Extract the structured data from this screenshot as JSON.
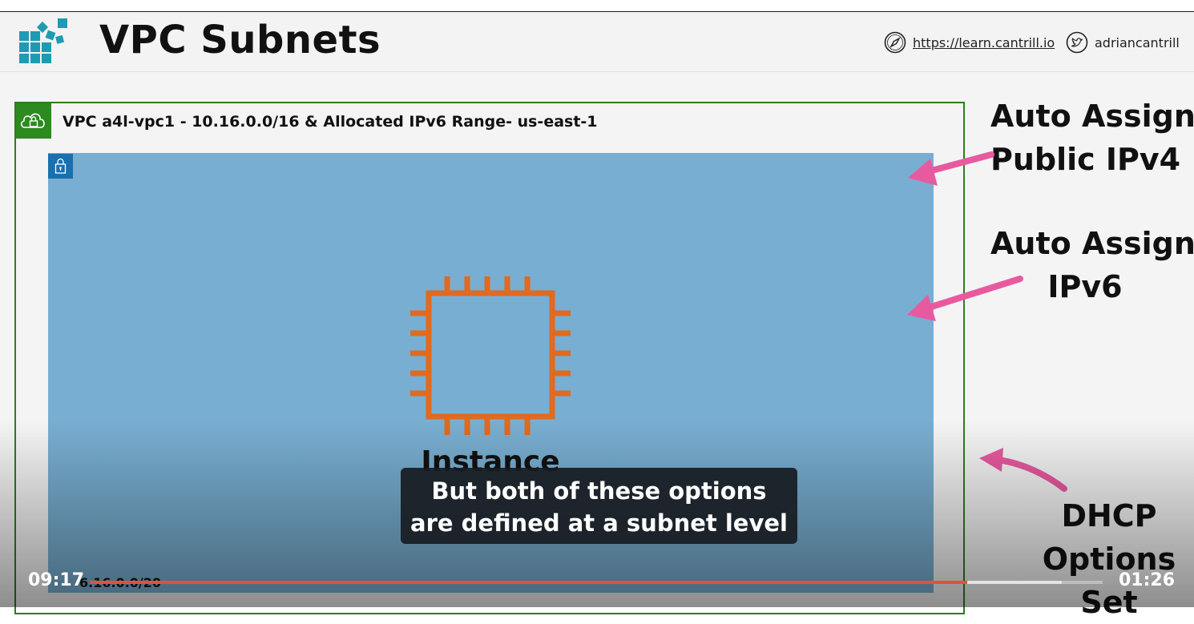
{
  "header": {
    "title": "VPC Subnets",
    "site_link": "https://learn.cantrill.io",
    "twitter_handle": "adriancantrill",
    "icons": {
      "logo": "cantrill-logo-icon",
      "site": "compass-icon",
      "twitter": "twitter-bird-icon"
    }
  },
  "diagram": {
    "vpc_label": "VPC a4l-vpc1 - 10.16.0.0/16 & Allocated IPv6 Range- us-east-1",
    "instance_label": "Instance",
    "subnet_cidr": "6.16.0.0/20",
    "icons": {
      "vpc": "vpc-cloud-lock-icon",
      "subnet": "subnet-lock-icon",
      "instance": "ec2-instance-chip-icon"
    },
    "annotations": {
      "ipv4_line1": "Auto Assign",
      "ipv4_line2": "Public IPv4",
      "ipv6_line1": "Auto Assign",
      "ipv6_line2": "IPv6",
      "dhcp_line1": "DHCP",
      "dhcp_line2": "Options",
      "dhcp_line3": "Set"
    },
    "colors": {
      "vpc_border": "#2c7d1f",
      "subnet_fill": "#78aed1",
      "instance": "#e06a1f",
      "arrow": "#e85aa0"
    }
  },
  "player": {
    "caption_line1": "But both of these options",
    "caption_line2": "are defined at a subnet level",
    "time_elapsed": "09:17",
    "time_remaining": "01:26",
    "progress_fraction": 0.866,
    "buffered_fraction": 0.96,
    "progress_color": "#e0523a"
  }
}
